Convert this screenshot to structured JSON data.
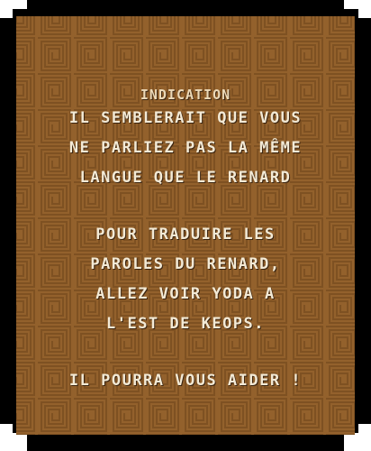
{
  "dialog": {
    "title": "Indication",
    "lines": [
      "Il semblerait que vous",
      "ne parliez pas la même",
      "langue que le renard",
      "Pour traduire les",
      "paroles du renard,",
      "allez voir Yoda a",
      "l'est de Keops.",
      "Il pourra vous aider !"
    ]
  },
  "colors": {
    "panel": "#93612c",
    "border": "#000000",
    "text": "#f3ead6"
  }
}
